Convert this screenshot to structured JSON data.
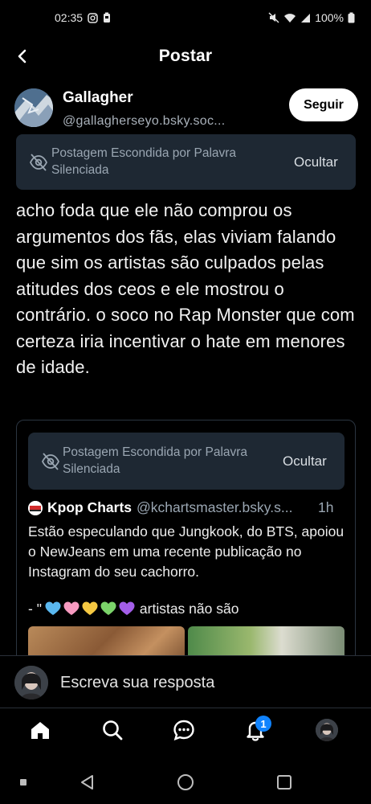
{
  "status_bar": {
    "time": "02:35",
    "battery": "100%"
  },
  "header": {
    "title": "Postar"
  },
  "post": {
    "author_name": "Gallagher",
    "author_handle": "@gallagherseyo.bsky.soc...",
    "follow_label": "Seguir",
    "hidden_notice": "Postagem Escondida por Palavra Silenciada",
    "hidden_action": "Ocultar",
    "text": "acho foda que ele não comprou os argumentos dos fãs, elas viviam falando que sim os artistas são culpados pelas atitudes dos ceos e ele mostrou o contrário. o soco no Rap Monster que com certeza iria incentivar o hate em menores de idade."
  },
  "quote": {
    "hidden_notice": "Postagem Escondida por Palavra Silenciada",
    "hidden_action": "Ocultar",
    "author_name": "Kpop Charts",
    "author_handle": "@kchartsmaster.bsky.s...",
    "time": "1h",
    "text": "Estão especulando que Jungkook, do BTS, apoiou o NewJeans em uma recente publicação no Instagram do seu cachorro.",
    "text2_prefix": "- \"",
    "text2_suffix": "artistas não são",
    "heart_colors": [
      "#5ab8f0",
      "#f79ac0",
      "#f5c842",
      "#7bd36a",
      "#a35ee8"
    ]
  },
  "reply": {
    "placeholder": "Escreva sua resposta"
  },
  "nav": {
    "items": [
      "home-icon",
      "search-icon",
      "chat-icon",
      "bell-icon",
      "profile-avatar"
    ],
    "notification_count": "1"
  },
  "colors": {
    "background": "#000000",
    "hidden_box": "#1e2833",
    "accent": "#1083fe"
  }
}
